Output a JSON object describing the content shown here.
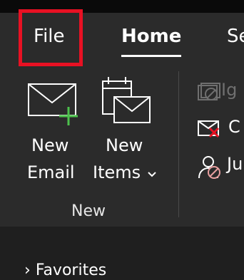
{
  "tabs": {
    "file": "File",
    "home": "Home",
    "next_partial": "Se"
  },
  "ribbon": {
    "new_email": {
      "line1": "New",
      "line2": "Email"
    },
    "new_items": {
      "line1": "New",
      "line2": "Items"
    },
    "group_new": "New",
    "ignore_partial": "Ig",
    "cleanup_partial": "C",
    "junk_partial": "Ju"
  },
  "nav": {
    "favorites_partial": "Favorites"
  },
  "colors": {
    "highlight": "#e81123",
    "plus": "#4cc24c",
    "junk_person": "#e8a0a0",
    "cleanup_x": "#e81123"
  },
  "icons": [
    "new-email-icon",
    "new-items-icon",
    "ignore-icon",
    "cleanup-icon",
    "junk-icon",
    "chevron-down-icon"
  ]
}
